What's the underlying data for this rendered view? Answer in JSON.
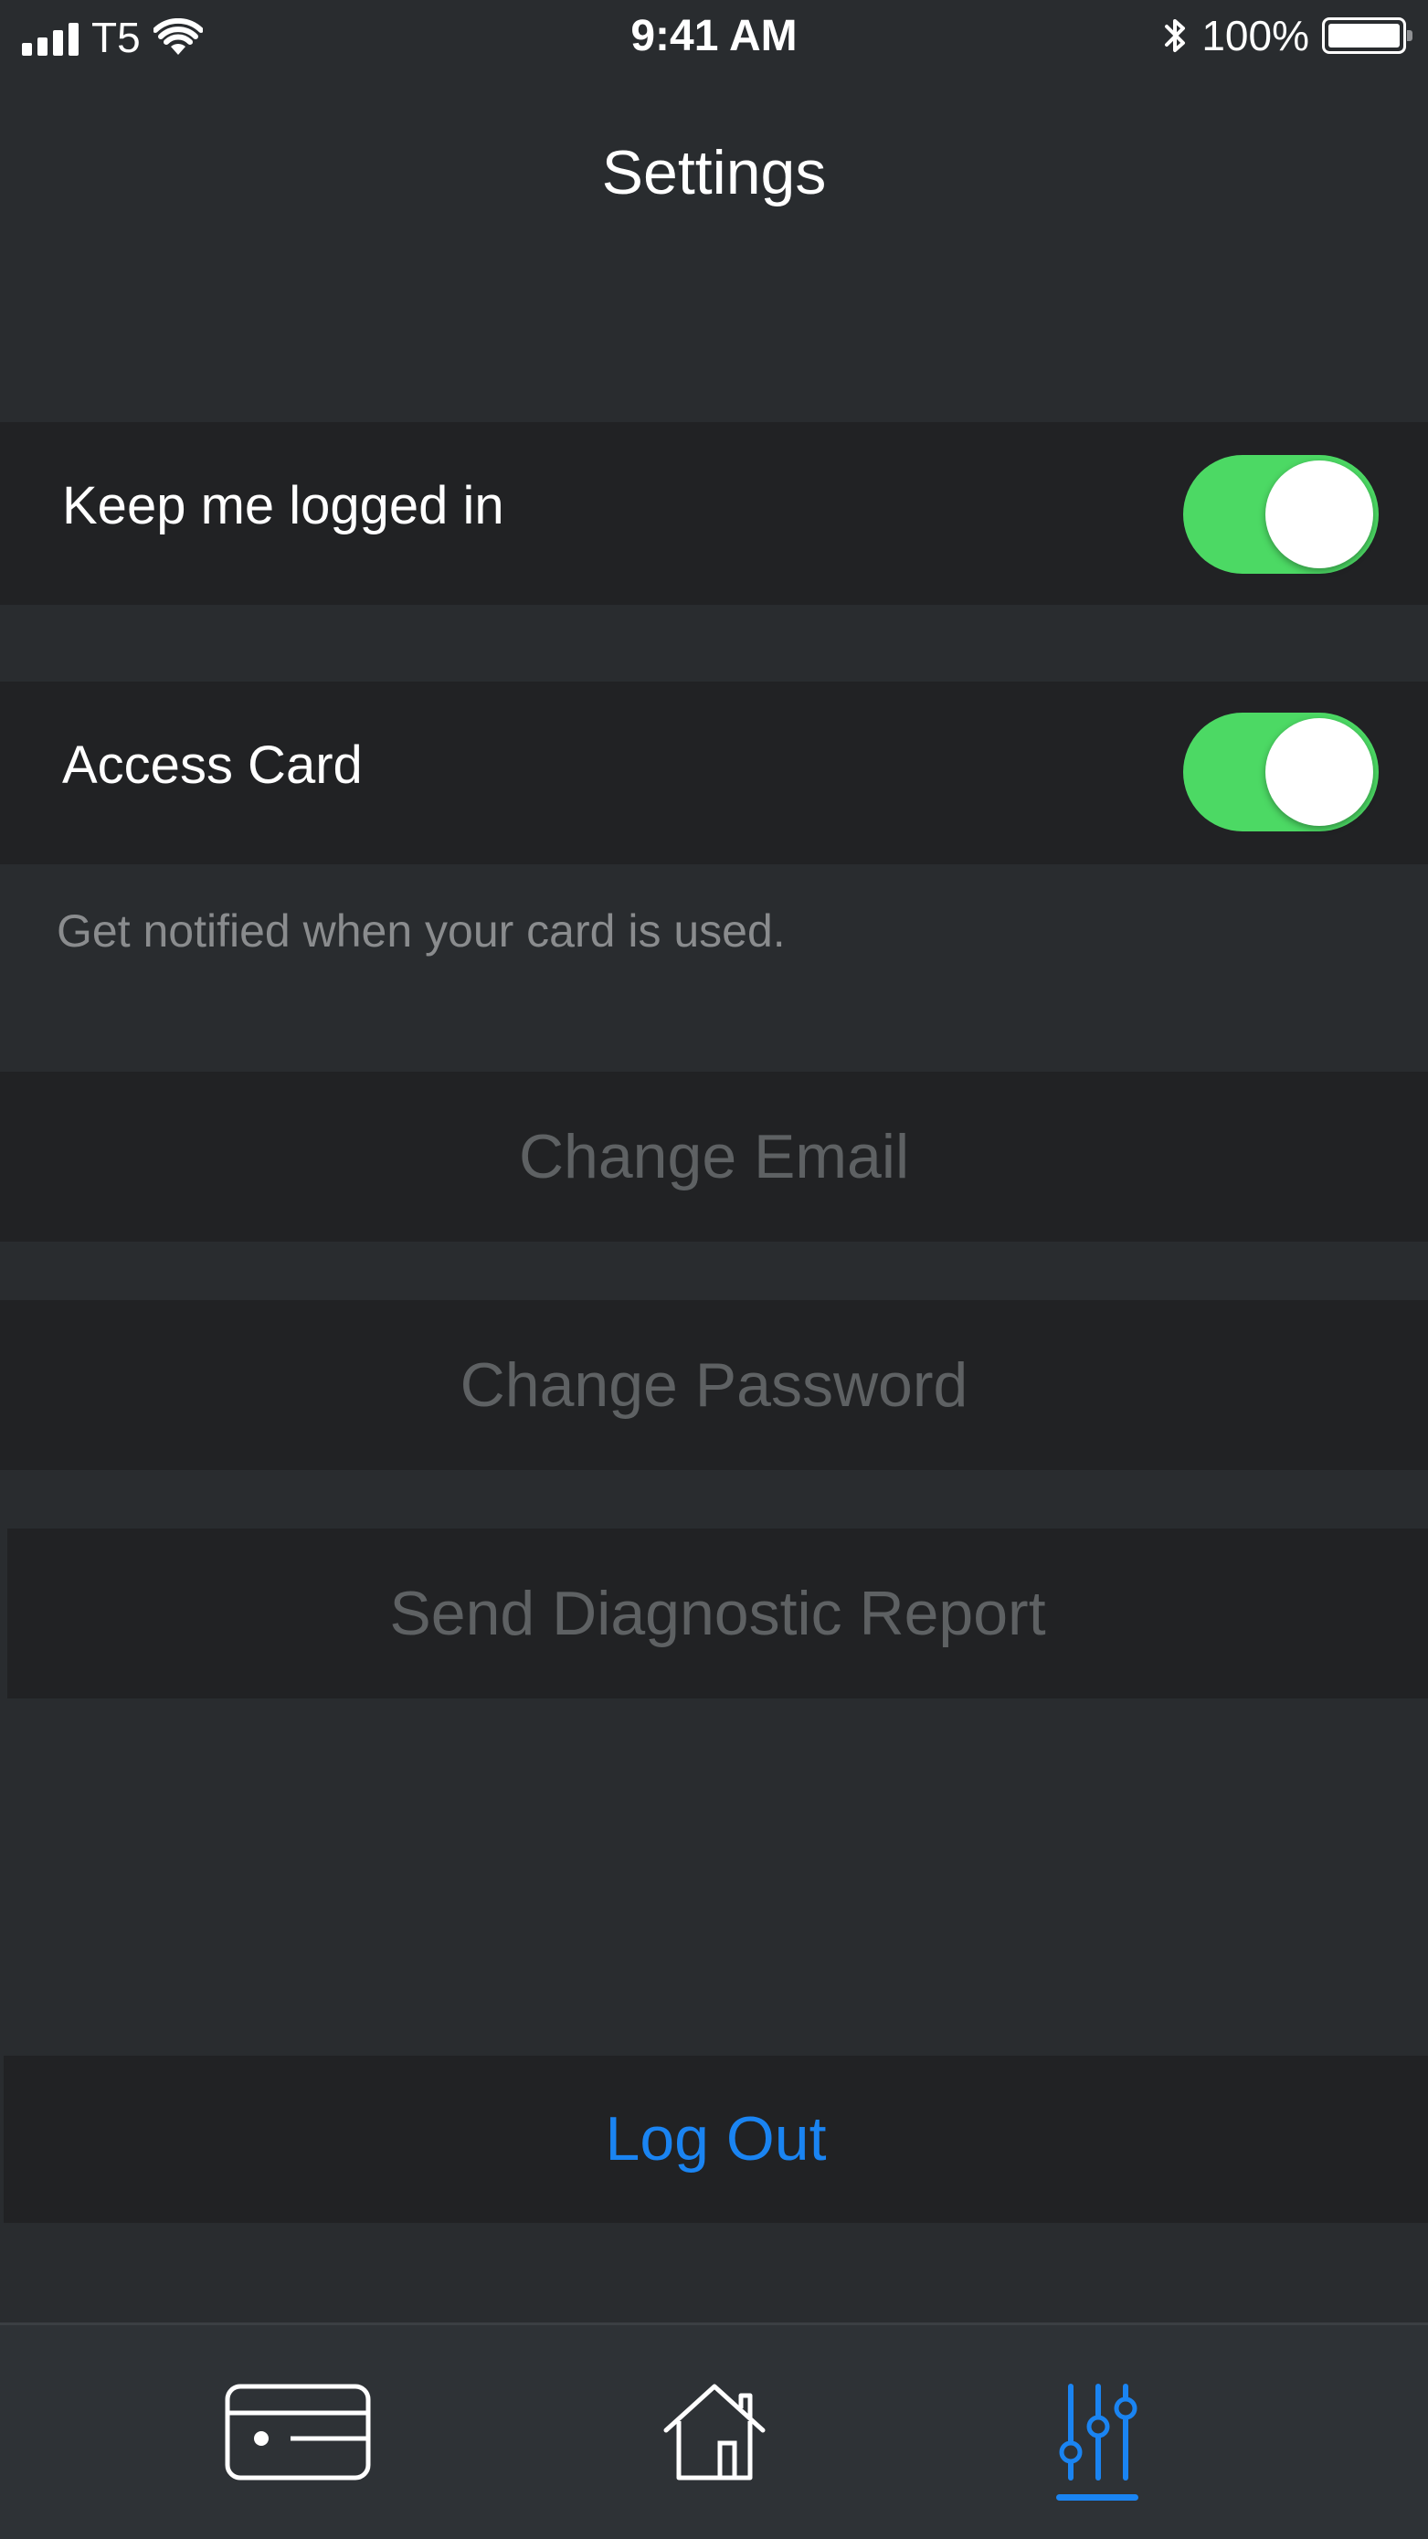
{
  "status_bar": {
    "carrier": "T5",
    "time": "9:41 AM",
    "battery": "100%",
    "icons": [
      "signal-icon",
      "wifi-icon",
      "bluetooth-icon",
      "battery-icon"
    ]
  },
  "nav": {
    "title": "Settings"
  },
  "settings": {
    "keep_logged_in": {
      "label": "Keep me logged in",
      "on": true
    },
    "access_card": {
      "label": "Access Card",
      "on": true,
      "footnote": "Get notified when your card is used."
    }
  },
  "actions": {
    "change_email": "Change Email",
    "change_password": "Change Password",
    "send_diagnostic": "Send Diagnostic Report",
    "log_out": "Log Out"
  },
  "tab_bar": {
    "tabs": [
      {
        "icon": "card-icon",
        "selected": false
      },
      {
        "icon": "home-icon",
        "selected": false
      },
      {
        "icon": "sliders-icon",
        "selected": true
      }
    ]
  },
  "colors": {
    "background": "#292c2f",
    "row": "#212224",
    "toggle_on": "#4cd964",
    "accent": "#1a84f2",
    "disabled_text": "#5e6163"
  }
}
